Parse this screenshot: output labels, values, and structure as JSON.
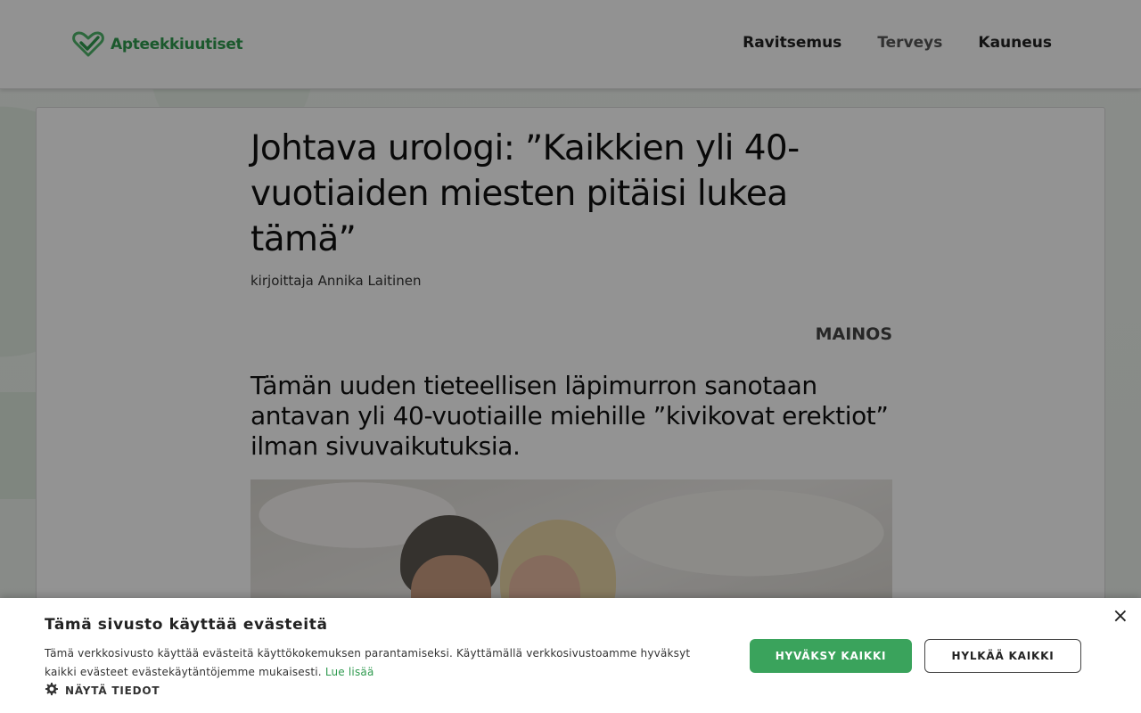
{
  "header": {
    "logo_text": "Apteekkiuutiset",
    "nav": [
      {
        "label": "Ravitsemus"
      },
      {
        "label": "Terveys"
      },
      {
        "label": "Kauneus"
      }
    ]
  },
  "article": {
    "title": "Johtava urologi: ”Kaikkien yli 40-vuotiaiden miesten pitäisi lukea tämä”",
    "byline": "kirjoittaja Annika Laitinen",
    "ad_label": "MAINOS",
    "lead": "Tämän uuden tieteellisen läpimurron sanotaan antavan yli 40-vuotiaille miehille ”kivikovat erektiot” ilman sivuvaikutuksia."
  },
  "cookie": {
    "title": "Tämä sivusto käyttää evästeitä",
    "text": "Tämä verkkosivusto käyttää evästeitä käyttökokemuksen parantamiseksi. Käyttämällä verkkosivustoamme hyväksyt kaikki evästeet evästekäytäntöjemme mukaisesti.",
    "read_more": "Lue lisää",
    "details_label": "NÄYTÄ TIEDOT",
    "accept_label": "HYVÄKSY KAIKKI",
    "reject_label": "HYLKÄÄ KAIKKI",
    "close_symbol": "×"
  },
  "colors": {
    "brand_green": "#2f9a4f",
    "accept_button": "#3aa35c"
  },
  "icons": {
    "logo": "heart-check-icon",
    "details": "gear-icon",
    "close": "close-icon"
  }
}
